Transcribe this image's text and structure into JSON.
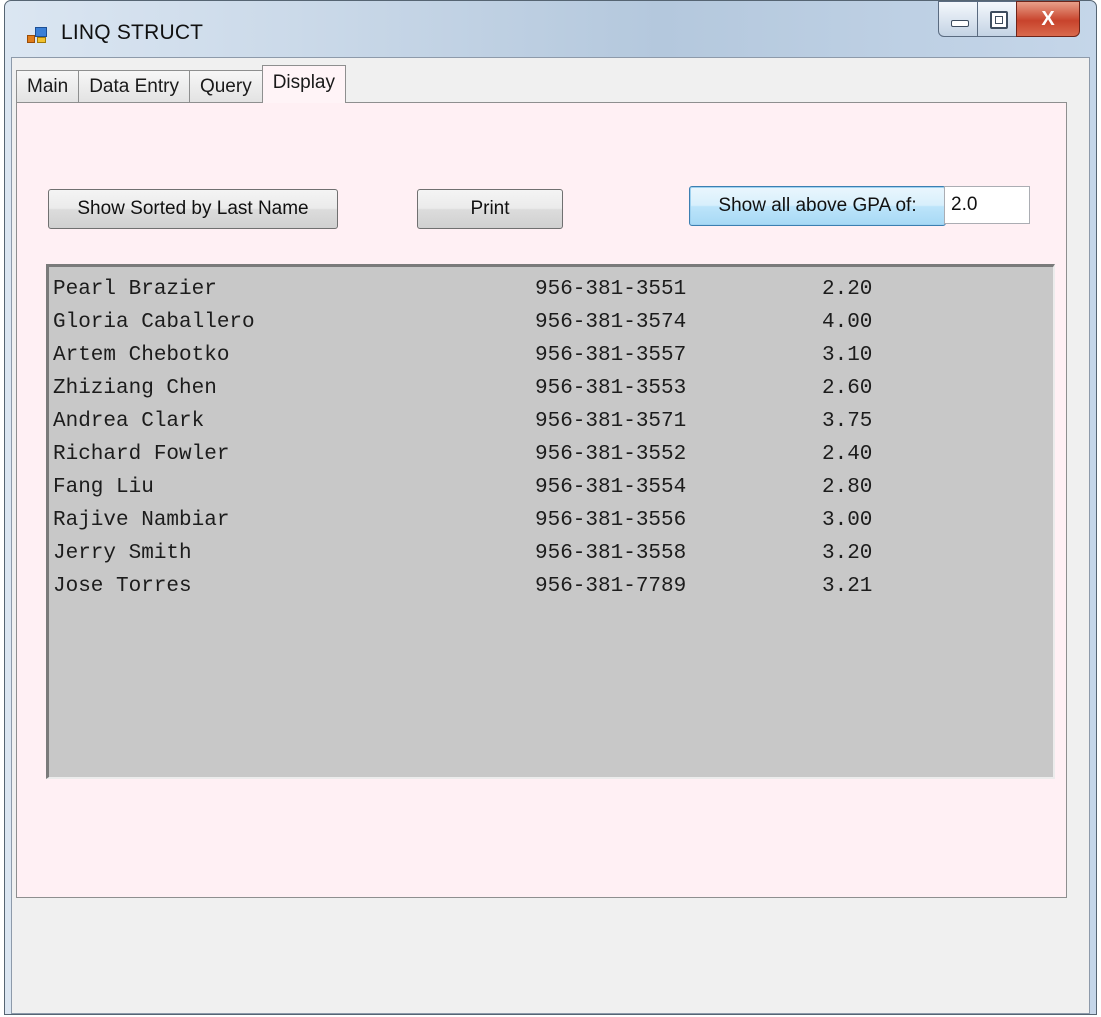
{
  "window": {
    "title": "LINQ STRUCT",
    "close_glyph": "X"
  },
  "tabs": [
    {
      "label": "Main"
    },
    {
      "label": "Data Entry"
    },
    {
      "label": "Query"
    },
    {
      "label": "Display",
      "selected": true
    }
  ],
  "display": {
    "sort_button": "Show Sorted by Last Name",
    "print_button": "Print",
    "gpa_button": "Show all above GPA of:",
    "gpa_value": "2.0",
    "rows": [
      {
        "name": "Pearl Brazier",
        "phone": "956-381-3551",
        "gpa": "2.20"
      },
      {
        "name": "Gloria Caballero",
        "phone": "956-381-3574",
        "gpa": "4.00"
      },
      {
        "name": "Artem Chebotko",
        "phone": "956-381-3557",
        "gpa": "3.10"
      },
      {
        "name": "Zhiziang Chen",
        "phone": "956-381-3553",
        "gpa": "2.60"
      },
      {
        "name": "Andrea Clark",
        "phone": "956-381-3571",
        "gpa": "3.75"
      },
      {
        "name": "Richard Fowler",
        "phone": "956-381-3552",
        "gpa": "2.40"
      },
      {
        "name": "Fang Liu",
        "phone": "956-381-3554",
        "gpa": "2.80"
      },
      {
        "name": "Rajive Nambiar",
        "phone": "956-381-3556",
        "gpa": "3.00"
      },
      {
        "name": "Jerry Smith",
        "phone": "956-381-3558",
        "gpa": "3.20"
      },
      {
        "name": "Jose Torres",
        "phone": "956-381-7789",
        "gpa": "3.21"
      }
    ]
  },
  "colors": {
    "tab_page_background": "#fff0f4",
    "listbox_background": "#c8c8c8",
    "client_background": "#f0f0f0"
  },
  "icons": {
    "app": "app-window-icon",
    "minimize": "minimize-icon",
    "maximize": "maximize-icon",
    "close": "close-icon"
  }
}
